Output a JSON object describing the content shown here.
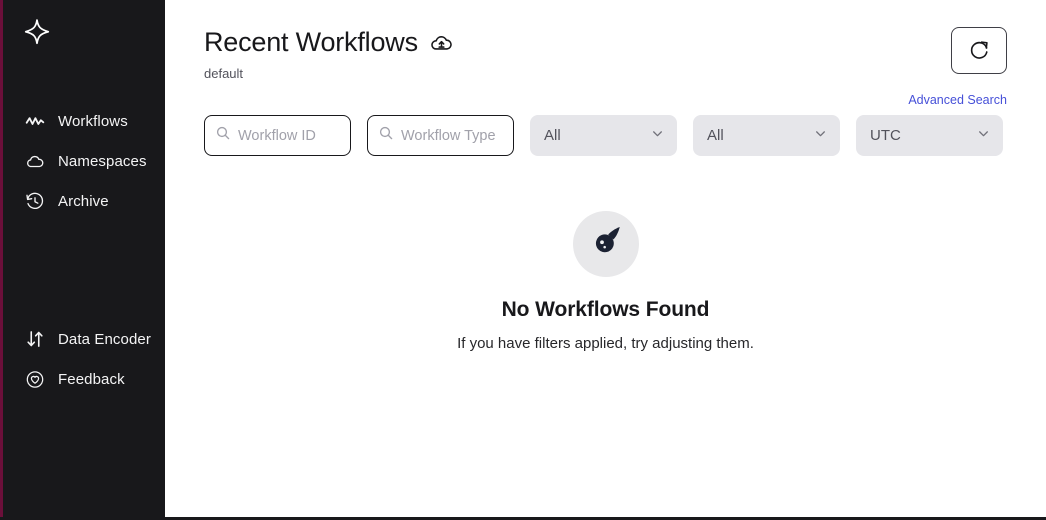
{
  "sidebar": {
    "logo_icon": "four-point-star-logo",
    "accent_color": "#6b0f3a",
    "background_color": "#18181b",
    "top_items": [
      {
        "label": "Workflows",
        "icon": "activity-zigzag-icon"
      },
      {
        "label": "Namespaces",
        "icon": "cloud-icon"
      },
      {
        "label": "Archive",
        "icon": "history-clock-icon"
      }
    ],
    "bottom_items": [
      {
        "label": "Data Encoder",
        "icon": "arrows-down-up-icon"
      },
      {
        "label": "Feedback",
        "icon": "heart-circle-icon"
      }
    ]
  },
  "header": {
    "title": "Recent Workflows",
    "title_icon": "cloud-upload-icon",
    "namespace": "default",
    "refresh_icon": "refresh-icon"
  },
  "filters": {
    "advanced_search_label": "Advanced Search",
    "advanced_search_color": "#4650d8",
    "workflow_id": {
      "value": "",
      "placeholder": "Workflow ID",
      "icon": "search-icon"
    },
    "workflow_type": {
      "value": "",
      "placeholder": "Workflow Type",
      "icon": "search-icon"
    },
    "status_select": {
      "value": "All",
      "icon": "chevron-down-icon"
    },
    "time_range_select": {
      "value": "All",
      "icon": "chevron-down-icon"
    },
    "timezone_select": {
      "value": "UTC",
      "icon": "chevron-down-icon"
    }
  },
  "empty_state": {
    "icon": "comet-icon",
    "title": "No Workflows Found",
    "subtitle": "If you have filters applied, try adjusting them."
  }
}
